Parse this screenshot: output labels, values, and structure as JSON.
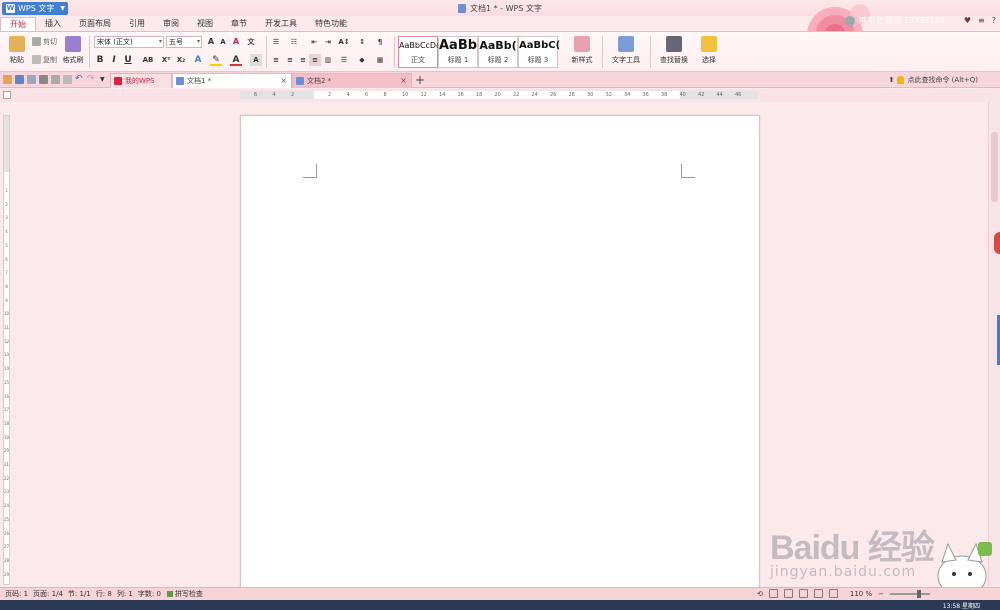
{
  "window": {
    "app_label": "WPS 文字",
    "title": "文档1 * - WPS 文字",
    "user": "坤车七 陆迅 13787174",
    "controls": [
      "≡",
      "?"
    ]
  },
  "menu": [
    "开始",
    "插入",
    "页面布局",
    "引用",
    "审阅",
    "视图",
    "章节",
    "开发工具",
    "特色功能"
  ],
  "ribbon": {
    "paste": "粘贴",
    "cut": "剪切",
    "copy": "复制",
    "format_painter": "格式刷",
    "font_name": "宋体 (正文)",
    "font_size": "五号",
    "bold": "B",
    "italic": "I",
    "underline": "U",
    "styles": [
      {
        "preview": "AaBbCcDd",
        "label": "正文"
      },
      {
        "preview": "AaBb",
        "label": "标题 1"
      },
      {
        "preview": "AaBb(",
        "label": "标题 2"
      },
      {
        "preview": "AaBbC(",
        "label": "标题 3"
      }
    ],
    "new_style": "新样式",
    "text_tools": "文字工具",
    "find_replace": "查找替换",
    "select": "选择"
  },
  "tabs": {
    "home": "我的WPS",
    "doc1": "文档1 *",
    "doc2": "文档2 *",
    "add": "+",
    "search_cmd": "点此查找命令 (Alt+Q)"
  },
  "ruler": {
    "h_ticks": [
      "6",
      "4",
      "2",
      "",
      "2",
      "4",
      "6",
      "8",
      "10",
      "12",
      "14",
      "16",
      "18",
      "20",
      "22",
      "24",
      "26",
      "28",
      "30",
      "32",
      "34",
      "36",
      "38",
      "40",
      "42",
      "44",
      "46"
    ],
    "v_ticks": [
      "1",
      "2",
      "3",
      "4",
      "5",
      "6",
      "7",
      "8",
      "9",
      "10",
      "11",
      "12",
      "13",
      "14",
      "15",
      "16",
      "17",
      "18",
      "19",
      "20",
      "21",
      "22",
      "23",
      "24",
      "25",
      "26",
      "27",
      "28",
      "29"
    ]
  },
  "status": {
    "page_no": "页码: 1",
    "pages": "页面: 1/4",
    "section": "节: 1/1",
    "row": "行: 8",
    "col": "列: 1",
    "words": "字数: 0",
    "spell": "拼写检查",
    "zoom": "110 %"
  },
  "watermark": {
    "logo": "Baidu 经验",
    "url": "jingyan.baidu.com"
  },
  "taskbar": {
    "clock": "13:58 星期四"
  },
  "colors": {
    "accent": "#3f7fd3",
    "pink_bg": "#fbe9ec",
    "tab_active": "#ffffff"
  }
}
